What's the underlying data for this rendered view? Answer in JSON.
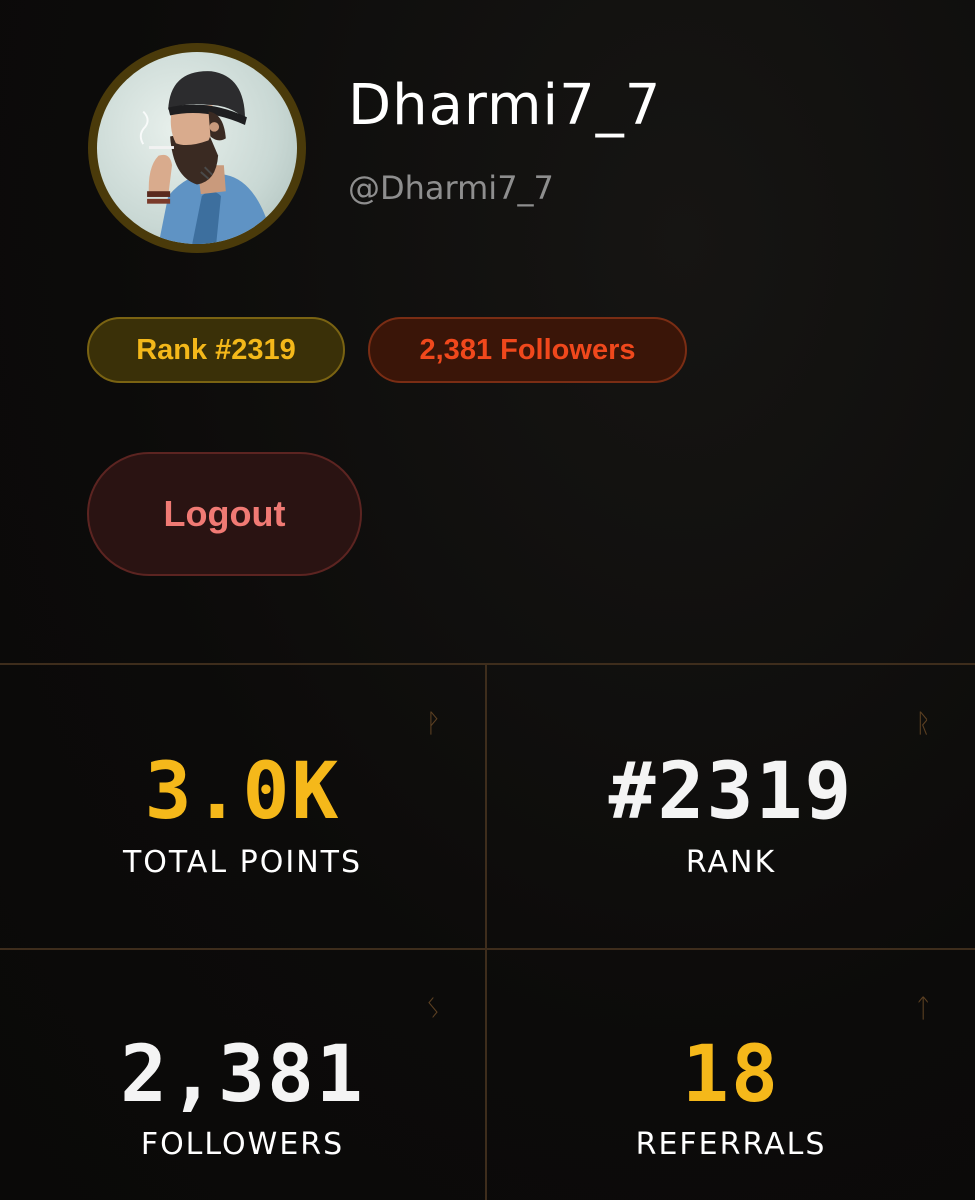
{
  "profile": {
    "display_name": "Dharmi7_7",
    "handle": "@Dharmi7_7"
  },
  "badges": {
    "rank": "Rank #2319",
    "followers": "2,381 Followers"
  },
  "actions": {
    "logout_label": "Logout"
  },
  "stats": [
    {
      "value": "3.0K",
      "label": "TOTAL POINTS",
      "glyph": "ᚹ",
      "icon": "points-rune-icon"
    },
    {
      "value": "#2319",
      "label": "RANK",
      "glyph": "ᚱ",
      "icon": "rank-rune-icon"
    },
    {
      "value": "2,381",
      "label": "FOLLOWERS",
      "glyph": "ᛊ",
      "icon": "followers-rune-icon"
    },
    {
      "value": "18",
      "label": "REFERRALS",
      "glyph": "ᛏ",
      "icon": "referrals-rune-icon"
    }
  ],
  "colors": {
    "accent_gold": "#f5b81a",
    "accent_orange": "#f0481c",
    "logout_text": "#f07a74",
    "background": "#0d0c0b",
    "grid_line": "#3e2d1c"
  }
}
